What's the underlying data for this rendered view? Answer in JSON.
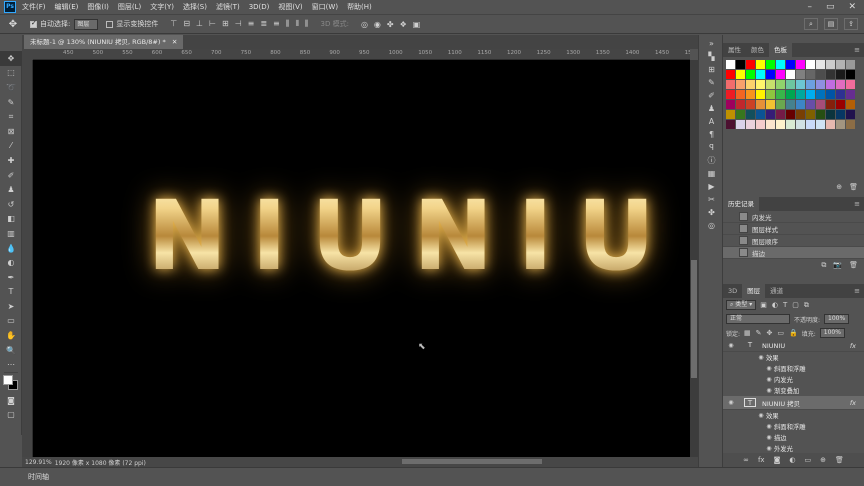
{
  "menu": {
    "logo": "Ps",
    "items": [
      "文件(F)",
      "编辑(E)",
      "图像(I)",
      "图层(L)",
      "文字(Y)",
      "选择(S)",
      "滤镜(T)",
      "3D(D)",
      "视图(V)",
      "窗口(W)",
      "帮助(H)"
    ]
  },
  "options": {
    "auto_select_label": "自动选择:",
    "auto_select_value": "图层",
    "show_transform_label": "显示变换控件",
    "mode_3d_label": "3D 模式:"
  },
  "document": {
    "tab_title": "未标题-1 @ 130% (NIUNIU 拷贝, RGB/8#) *",
    "ruler_ticks": [
      "450",
      "500",
      "550",
      "600",
      "650",
      "700",
      "750",
      "800",
      "850",
      "900",
      "950",
      "1000",
      "1050",
      "1100",
      "1150",
      "1200",
      "1250",
      "1300",
      "1350",
      "1400",
      "1450",
      "1500"
    ],
    "canvas_text": "NIUNIU",
    "zoom": "129.91%",
    "doc_info": "1920 像素 x 1080 像素 (72 ppi)",
    "timeline_label": "时间轴"
  },
  "swatches_panel": {
    "tabs": [
      "属性",
      "颜色",
      "色板"
    ],
    "active_tab": "色板",
    "colors": [
      "#ffffff",
      "#000000",
      "#ff0000",
      "#ffff00",
      "#00ff00",
      "#00ffff",
      "#0000ff",
      "#ff00ff",
      "#ffffff",
      "#e6e6e6",
      "#cccccc",
      "#b3b3b3",
      "#999999",
      "#ff0000",
      "#ffff00",
      "#00ff00",
      "#00ffff",
      "#0000ff",
      "#ff00ff",
      "#ffffff",
      "#808080",
      "#666666",
      "#4d4d4d",
      "#333333",
      "#1a1a1a",
      "#000000",
      "#f26c6c",
      "#f7a06c",
      "#fbd26c",
      "#fff56c",
      "#c6e06c",
      "#8fd36c",
      "#6cc6a0",
      "#6cc6d3",
      "#6ca0e0",
      "#8f8fe0",
      "#c06ce0",
      "#e06cc0",
      "#f26c9b",
      "#ed1c24",
      "#f26522",
      "#f7941d",
      "#fff200",
      "#8dc63f",
      "#39b54a",
      "#00a651",
      "#00a99d",
      "#00aeef",
      "#0072bc",
      "#0054a6",
      "#2e3192",
      "#662d91",
      "#9e005d",
      "#c1272d",
      "#cc4125",
      "#e69138",
      "#f1c232",
      "#6aa84f",
      "#45818e",
      "#3d85c6",
      "#674ea7",
      "#a64d79",
      "#85200c",
      "#990000",
      "#b45f06",
      "#bf9000",
      "#38761d",
      "#134f5c",
      "#0b5394",
      "#351c75",
      "#741b47",
      "#660000",
      "#783f04",
      "#7f6000",
      "#274e13",
      "#0c343d",
      "#073763",
      "#20124d",
      "#4c1130",
      "#d9d2e9",
      "#ead1dc",
      "#f4cccc",
      "#fce5cd",
      "#fff2cc",
      "#d9ead3",
      "#d0e0e3",
      "#c9daf8",
      "#cfe2f3",
      "#e6b8af",
      "#a39580",
      "#8c6d46"
    ]
  },
  "history_panel": {
    "tab": "历史记录",
    "items": [
      "内发光",
      "图层样式",
      "图层顺序",
      "描边"
    ],
    "selected_index": 3
  },
  "layers_panel": {
    "tabs": [
      "3D",
      "图层",
      "通道"
    ],
    "active_tab": "图层",
    "filter_label": "类型",
    "blend_mode": "正常",
    "opacity_label": "不透明度:",
    "opacity": "100%",
    "lock_label": "锁定:",
    "fill_label": "填充:",
    "fill": "100%",
    "layers": [
      {
        "name": "NIUNIU",
        "effects_label": "效果",
        "effects": [
          "斜面和浮雕",
          "内发光",
          "渐变叠加"
        ],
        "selected": false
      },
      {
        "name": "NIUNIU 拷贝",
        "effects_label": "效果",
        "effects": [
          "斜面和浮雕",
          "描边",
          "外发光"
        ],
        "selected": true
      }
    ]
  }
}
